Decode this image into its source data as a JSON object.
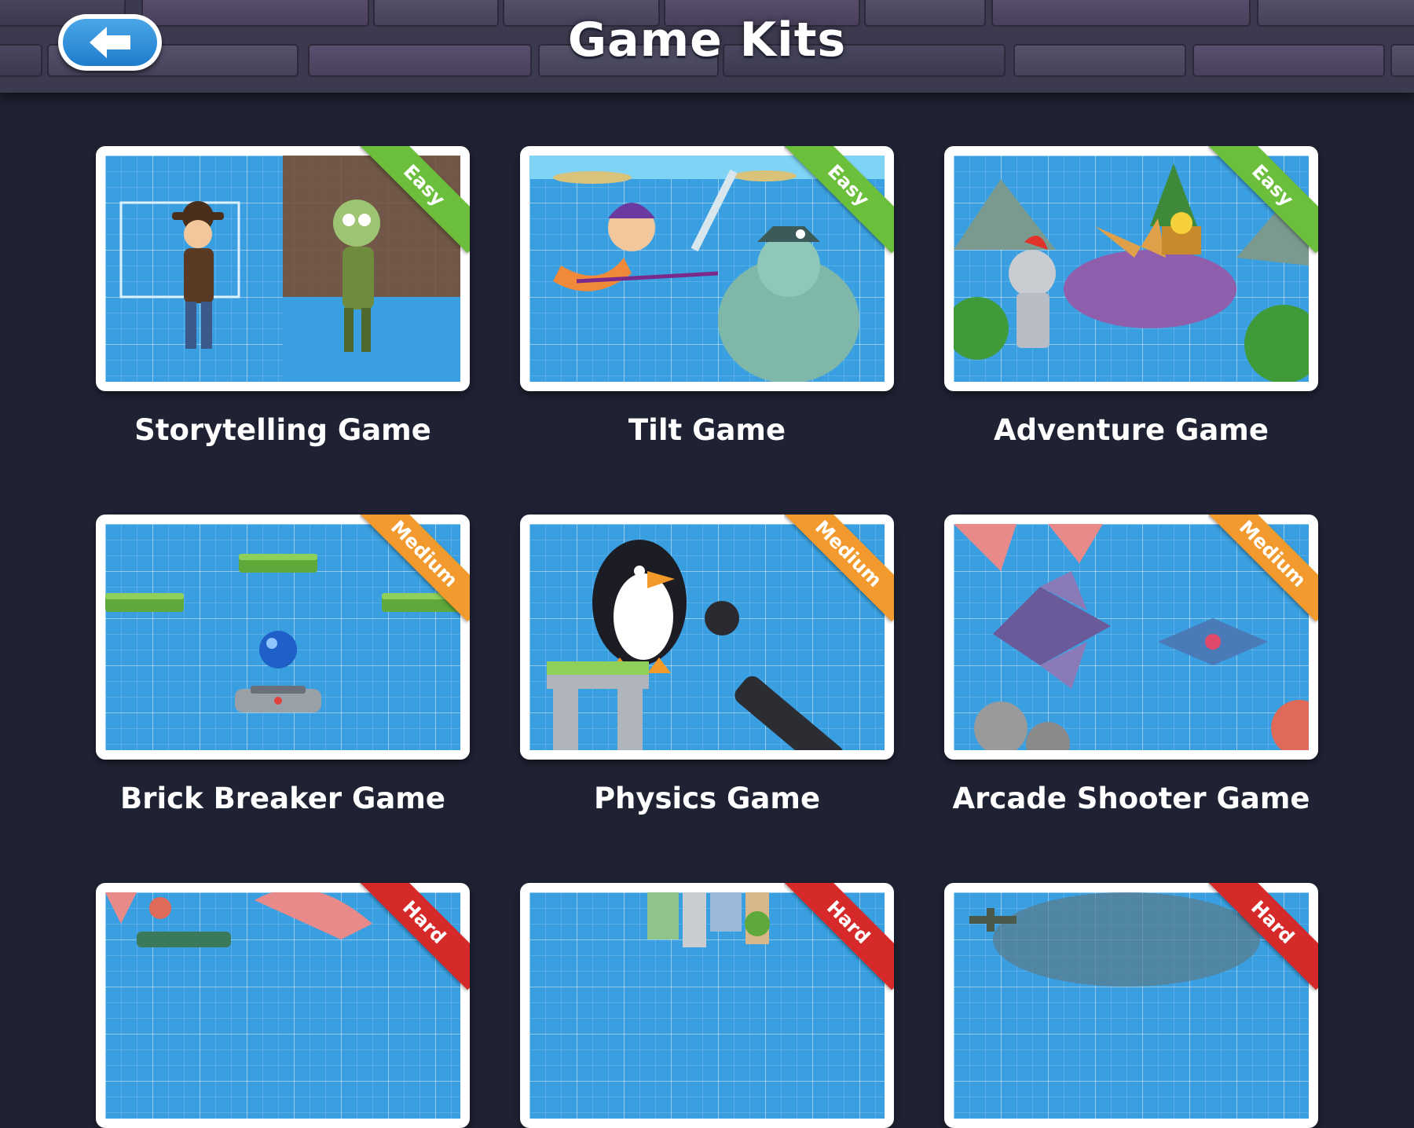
{
  "header": {
    "title": "Game Kits",
    "back_icon": "arrow-left-icon"
  },
  "difficulty_colors": {
    "Easy": "#6cbf3b",
    "Medium": "#f29a2e",
    "Hard": "#d62a2a"
  },
  "kits": [
    {
      "name": "Storytelling Game",
      "difficulty": "Easy"
    },
    {
      "name": "Tilt Game",
      "difficulty": "Easy"
    },
    {
      "name": "Adventure Game",
      "difficulty": "Easy"
    },
    {
      "name": "Brick Breaker Game",
      "difficulty": "Medium"
    },
    {
      "name": "Physics Game",
      "difficulty": "Medium"
    },
    {
      "name": "Arcade Shooter Game",
      "difficulty": "Medium"
    },
    {
      "name": "",
      "difficulty": "Hard"
    },
    {
      "name": "",
      "difficulty": "Hard"
    },
    {
      "name": "",
      "difficulty": "Hard"
    }
  ]
}
